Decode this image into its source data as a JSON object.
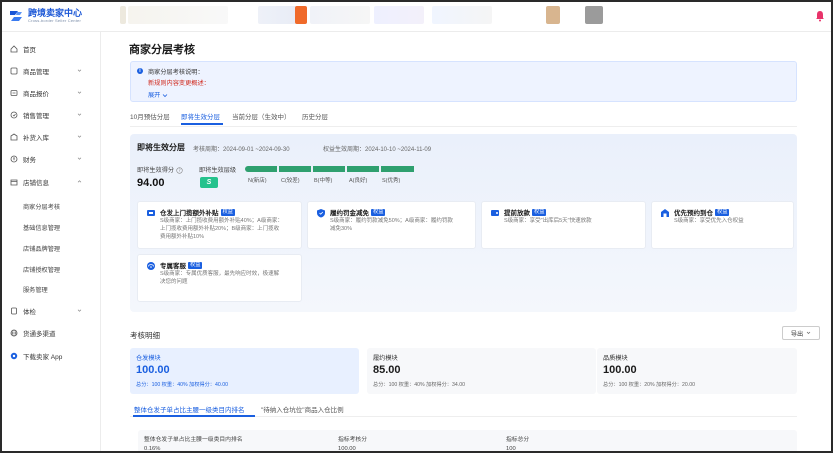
{
  "app": {
    "name": "跨境卖家中心",
    "name_en": "Cross-border Seller Center"
  },
  "colors": {
    "primary": "#1a5fe0",
    "success": "#24c28d",
    "danger": "#d0281c",
    "bell": "#e8336a"
  },
  "sidebar": {
    "items": [
      {
        "label": "首页",
        "icon": "home-icon"
      },
      {
        "label": "商品管理",
        "icon": "product-icon",
        "chevron": true
      },
      {
        "label": "商品报价",
        "icon": "price-icon",
        "chevron": true
      },
      {
        "label": "销售管理",
        "icon": "sales-icon",
        "chevron": true
      },
      {
        "label": "补货入库",
        "icon": "restock-icon",
        "chevron": true
      },
      {
        "label": "财务",
        "icon": "finance-icon",
        "chevron": true
      },
      {
        "label": "店铺信息",
        "icon": "store-icon",
        "chevron": true,
        "expanded": true
      },
      {
        "label": "体检",
        "icon": "checkup-icon",
        "chevron": true
      },
      {
        "label": "货通多渠道",
        "icon": "globe-icon"
      },
      {
        "label": "下载卖家 App",
        "icon": "app-icon"
      }
    ],
    "store_sub": [
      "商家分层考核",
      "基础信息管理",
      "店铺品牌管理",
      "店铺授权管理",
      "服务管理"
    ]
  },
  "page": {
    "title": "商家分层考核"
  },
  "notice": {
    "title": "商家分层考核说明：",
    "subtitle": "新规则内容变更概述：",
    "expand": "展开"
  },
  "tabs": [
    "10月预估分层",
    "即将生效分层",
    "当前分层（生效中）",
    "历史分层"
  ],
  "tier": {
    "title": "即将生效分层",
    "assess_period": "考核周期：2024-09-01 ~2024-09-30",
    "benefit_period": "权益生效周期：2024-10-10 ~2024-11-09",
    "score_label": "即将生效得分",
    "score": "94.00",
    "level_label": "即将生效层级",
    "level": "S",
    "scale": [
      "N(新店)",
      "C(较差)",
      "B(中等)",
      "A(良好)",
      "S(优秀)"
    ]
  },
  "benefits": [
    {
      "title": "仓发上门揽额外补贴",
      "badge": "权益",
      "icon": "subsidy-icon",
      "desc": [
        "S级商家：上门揽收费用额外补贴40%；A级商家：",
        "上门揽收费用额外补贴20%；B级商家：上门揽收",
        "费用额外补贴10%"
      ]
    },
    {
      "title": "履约罚金减免",
      "badge": "权益",
      "icon": "shield-icon",
      "desc": [
        "S级商家：履约罚款减免50%；A级商家：履约罚款",
        "减免30%"
      ]
    },
    {
      "title": "提前放款",
      "badge": "权益",
      "icon": "wallet-icon",
      "desc": [
        "S级商家：享受\"出库后5天\"快速放款"
      ]
    },
    {
      "title": "优先预约到仓",
      "badge": "权益",
      "icon": "warehouse-icon",
      "desc": [
        "S级商家：享受优先入仓权益"
      ]
    },
    {
      "title": "专属客服",
      "badge": "权益",
      "icon": "support-icon",
      "desc": [
        "S级商家：专属优质客服，最先响应时效，极速解",
        "决您的问题"
      ]
    }
  ],
  "assessment": {
    "title": "考核明细",
    "export": "导出",
    "modules": [
      {
        "name": "仓发模块",
        "value": "100.00",
        "meta": "总分：100    权重：40%    加权得分：40.00"
      },
      {
        "name": "履约模块",
        "value": "85.00",
        "meta": "总分：100    权重：40%    加权得分：34.00"
      },
      {
        "name": "品质模块",
        "value": "100.00",
        "meta": "总分：100    权重：20%    加权得分：20.00"
      }
    ],
    "sub_tabs": [
      "整体仓发子单占比主腰一级类目内排名",
      "\"待纳入仓坑位\"商品入仓比例"
    ],
    "detail": {
      "metric_name": "整体仓发子单占比主腰一级类目内排名",
      "metric_value": "0.16%",
      "level_label": "指标考核分",
      "level_value": "100.00",
      "total_label": "指标总分",
      "total_value": "100"
    }
  }
}
